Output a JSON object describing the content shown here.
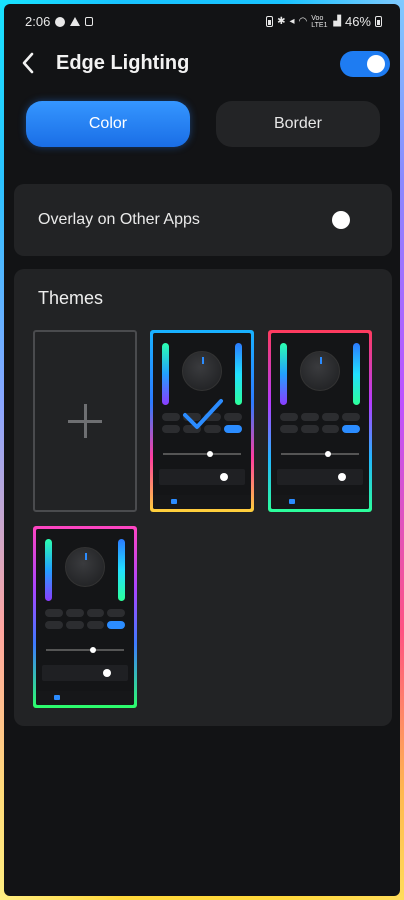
{
  "status_bar": {
    "time": "2:06",
    "battery": "46%",
    "signal_text": "Voo LTE1"
  },
  "header": {
    "title": "Edge Lighting",
    "back_icon": "chevron-left-icon",
    "toggle_on": true
  },
  "tabs": {
    "color_label": "Color",
    "border_label": "Border",
    "selected": "Color"
  },
  "overlay": {
    "label": "Overlay on Other Apps",
    "enabled": false
  },
  "themes": {
    "title": "Themes",
    "add_icon": "plus-icon",
    "items": [
      {
        "selected": true
      },
      {
        "selected": false
      },
      {
        "selected": false
      }
    ]
  },
  "colors": {
    "accent": "#1e7cf2",
    "card": "#222325",
    "background": "#121315"
  }
}
